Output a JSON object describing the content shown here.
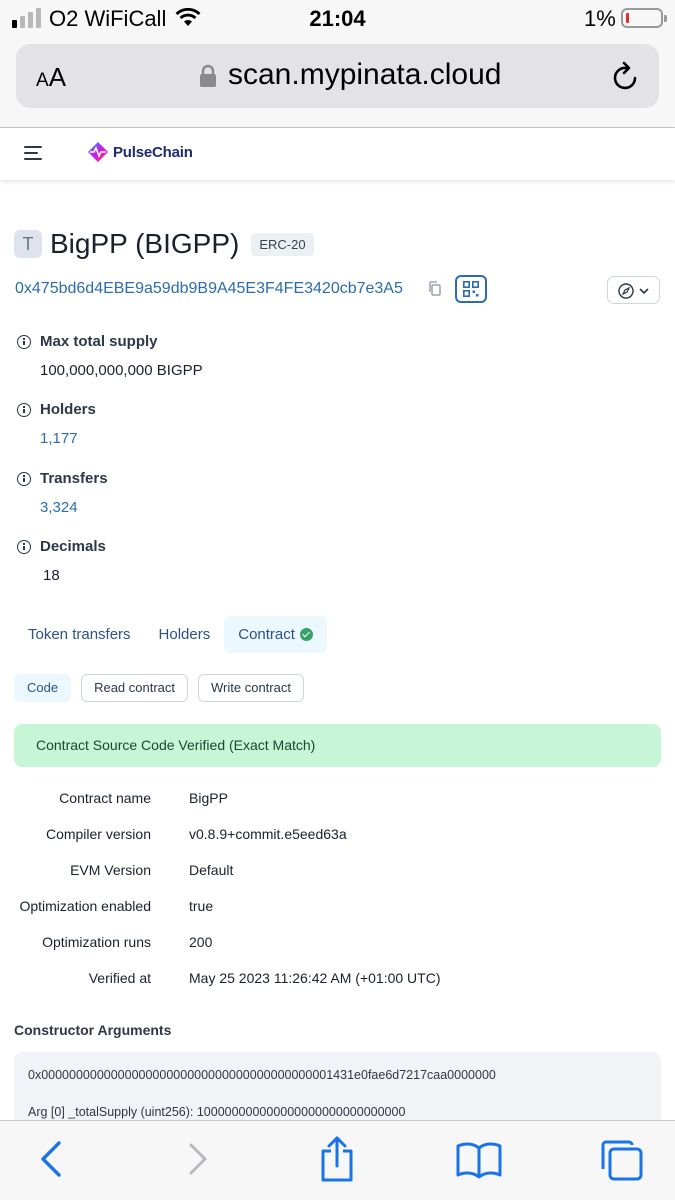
{
  "status_bar": {
    "carrier": "O2 WiFiCall",
    "time": "21:04",
    "battery_percent": "1%",
    "battery_level_fraction": 0.01,
    "signal_bars_on": 1,
    "signal_bars_total": 4
  },
  "browser": {
    "text_size_label": "AA",
    "url": "scan.mypinata.cloud",
    "icons": [
      "lock-icon",
      "reload-icon",
      "back-icon",
      "forward-icon",
      "share-icon",
      "bookmarks-icon",
      "tabs-icon"
    ]
  },
  "site": {
    "logo_text": "PulseChain"
  },
  "token": {
    "avatar_letter": "T",
    "name": "BigPP (BIGPP)",
    "standard": "ERC-20",
    "address": "0x475bd6d4EBE9a59db9B9A45E3F4FE3420cb7e3A5"
  },
  "info": [
    {
      "label": "Max total supply",
      "value": "100,000,000,000 BIGPP"
    },
    {
      "label": "Holders",
      "value": "1,177"
    },
    {
      "label": "Transfers",
      "value": "3,324"
    },
    {
      "label": "Decimals",
      "value": "18"
    }
  ],
  "tabs": [
    {
      "label": "Token transfers"
    },
    {
      "label": "Holders"
    },
    {
      "label": "Contract",
      "active": true
    }
  ],
  "subtabs": [
    {
      "label": "Code",
      "active": true
    },
    {
      "label": "Read contract"
    },
    {
      "label": "Write contract"
    }
  ],
  "verified_message": "Contract Source Code Verified (Exact Match)",
  "contract_details": [
    {
      "key": "Contract name",
      "value": "BigPP"
    },
    {
      "key": "Compiler version",
      "value": "v0.8.9+commit.e5eed63a"
    },
    {
      "key": "EVM Version",
      "value": "Default"
    },
    {
      "key": "Optimization enabled",
      "value": "true"
    },
    {
      "key": "Optimization runs",
      "value": "200"
    },
    {
      "key": "Verified at",
      "value": "May 25 2023 11:26:42 AM (+01:00 UTC)"
    }
  ],
  "constructor": {
    "title": "Constructor Arguments",
    "raw": "0x000000000000000000000000000000000000000001431e0fae6d7217caa0000000",
    "args": [
      "Arg [0] _totalSupply (uint256): 100000000000000000000000000000"
    ]
  },
  "colors": {
    "link": "#2b6cb0",
    "verified_bg": "#c6f6d5",
    "active_tab_bg": "#ebf8ff",
    "check_green": "#38a169",
    "battery_red": "#e32d2d",
    "safari_blue": "#1a73e8"
  }
}
